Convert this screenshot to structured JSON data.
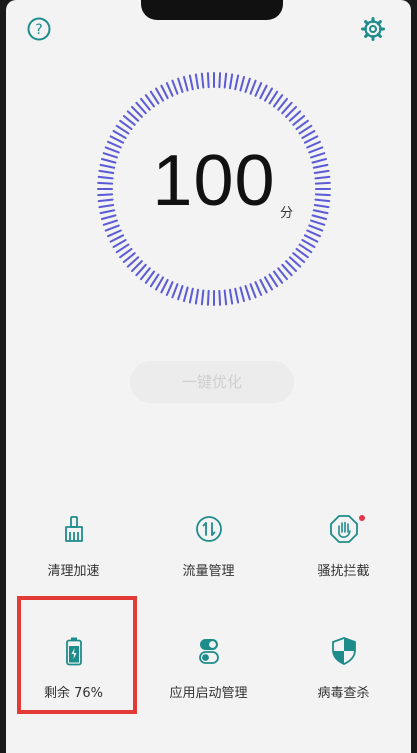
{
  "score": {
    "value": "100",
    "unit": "分"
  },
  "optimize": {
    "label": "一键优化"
  },
  "tools": [
    {
      "label": "清理加速",
      "icon": "broom-icon"
    },
    {
      "label": "流量管理",
      "icon": "data-flow-icon"
    },
    {
      "label": "骚扰拦截",
      "icon": "hand-stop-icon"
    },
    {
      "label": "剩余 76%",
      "icon": "battery-icon",
      "battery_percent": 76
    },
    {
      "label": "应用启动管理",
      "icon": "toggle-icon"
    },
    {
      "label": "病毒查杀",
      "icon": "shield-icon"
    }
  ],
  "colors": {
    "accent": "#1f8c8c",
    "dial": "#5b5bd6",
    "highlight": "#e23b36",
    "badge": "#e0374a"
  }
}
